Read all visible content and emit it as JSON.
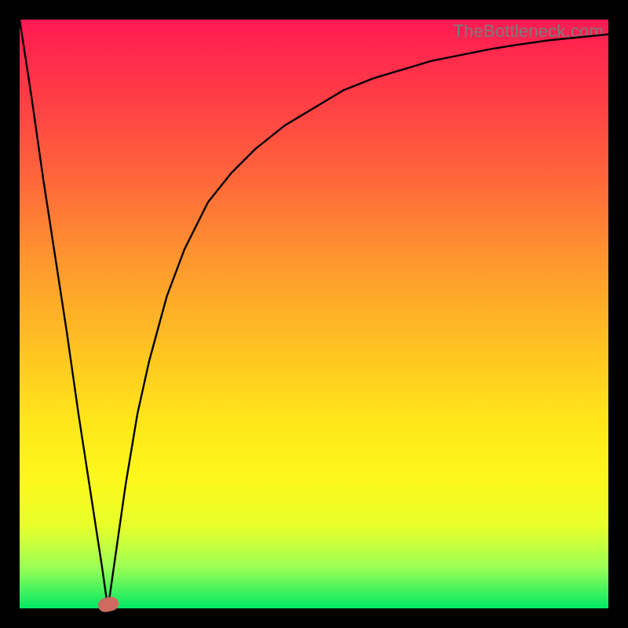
{
  "watermark": "TheBottleneck.com",
  "colors": {
    "frame": "#000000",
    "gradient_top": "#ff1a53",
    "gradient_bottom": "#00e965",
    "curve": "#000000",
    "marker": "#cf6a61"
  },
  "chart_data": {
    "type": "line",
    "title": "",
    "xlabel": "",
    "ylabel": "",
    "xlim": [
      0,
      100
    ],
    "ylim": [
      0,
      100
    ],
    "grid": false,
    "legend": false,
    "series": [
      {
        "name": "bottleneck-curve",
        "x": [
          0,
          2,
          4,
          6,
          8,
          10,
          12,
          14,
          15,
          16,
          18,
          20,
          22,
          25,
          28,
          32,
          36,
          40,
          45,
          50,
          55,
          60,
          65,
          70,
          75,
          80,
          85,
          90,
          95,
          100
        ],
        "y": [
          100,
          87,
          73,
          60,
          47,
          33,
          20,
          7,
          0,
          7,
          21,
          33,
          42,
          53,
          61,
          69,
          74,
          78,
          82,
          85,
          88,
          90,
          91.5,
          93,
          94,
          95,
          95.8,
          96.5,
          97,
          97.5
        ]
      }
    ],
    "marker": {
      "x": 15,
      "y": 0
    }
  }
}
